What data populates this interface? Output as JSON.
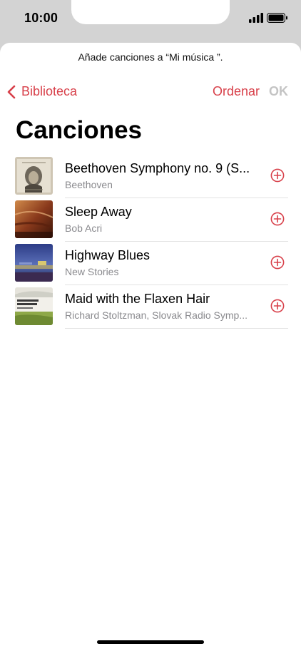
{
  "status_bar": {
    "time": "10:00"
  },
  "sheet": {
    "prompt": "Añade canciones a “Mi música ”."
  },
  "nav": {
    "back_label": "Biblioteca",
    "sort_label": "Ordenar",
    "ok_label": "OK"
  },
  "page": {
    "title": "Canciones"
  },
  "songs": [
    {
      "title": "Beethoven Symphony no. 9 (S...",
      "artist": "Beethoven",
      "art": "beethoven-art"
    },
    {
      "title": "Sleep Away",
      "artist": "Bob Acri",
      "art": "sleep-away-art"
    },
    {
      "title": "Highway Blues",
      "artist": "New Stories",
      "art": "highway-blues-art"
    },
    {
      "title": "Maid with the Flaxen Hair",
      "artist": "Richard Stoltzman, Slovak Radio Symp...",
      "art": "stoltzman-art"
    }
  ],
  "icons": {
    "back": "chevron-left-icon",
    "add": "add-circle-icon",
    "signal": "signal-icon",
    "battery": "battery-icon"
  },
  "colors": {
    "accent": "#d8404a",
    "disabled": "#c4c4c4",
    "secondary_text": "#8a8a8e"
  }
}
